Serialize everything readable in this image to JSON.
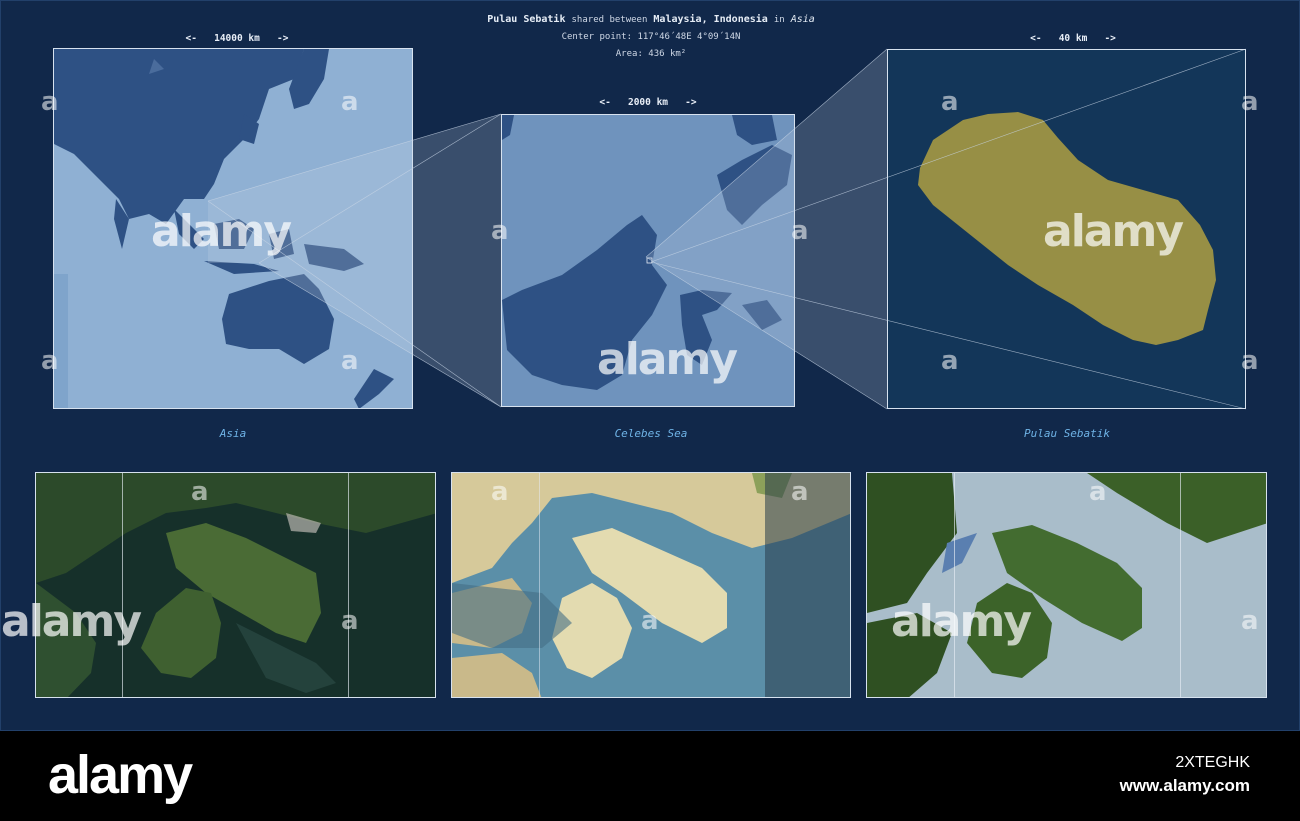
{
  "header": {
    "place": "Pulau Sebatik",
    "shared_text": "shared between",
    "countries": "Malaysia, Indonesia",
    "in_text": "in",
    "continent": "Asia",
    "center_label": "Center point:",
    "center_value": "117°46´48E  4°09´14N",
    "area_label": "Area:",
    "area_value": "436 km²"
  },
  "scales": {
    "left": "<-   14000 km   ->",
    "middle": "<-   2000 km   ->",
    "right": "<-   40 km   ->"
  },
  "captions": {
    "left": "Asia",
    "middle": "Celebes Sea",
    "right": "Pulau Sebatik"
  },
  "colors": {
    "background": "#11284a",
    "ocean_light": "#8fb0d3",
    "land_dark": "#2e5184",
    "island_fill": "#978f45",
    "caption": "#6fb3e6"
  },
  "watermark": {
    "logo": "alamy",
    "small_mark": "a"
  },
  "footer": {
    "logo": "alamy",
    "image_id": "2XTEGHK",
    "url": "www.alamy.com"
  }
}
